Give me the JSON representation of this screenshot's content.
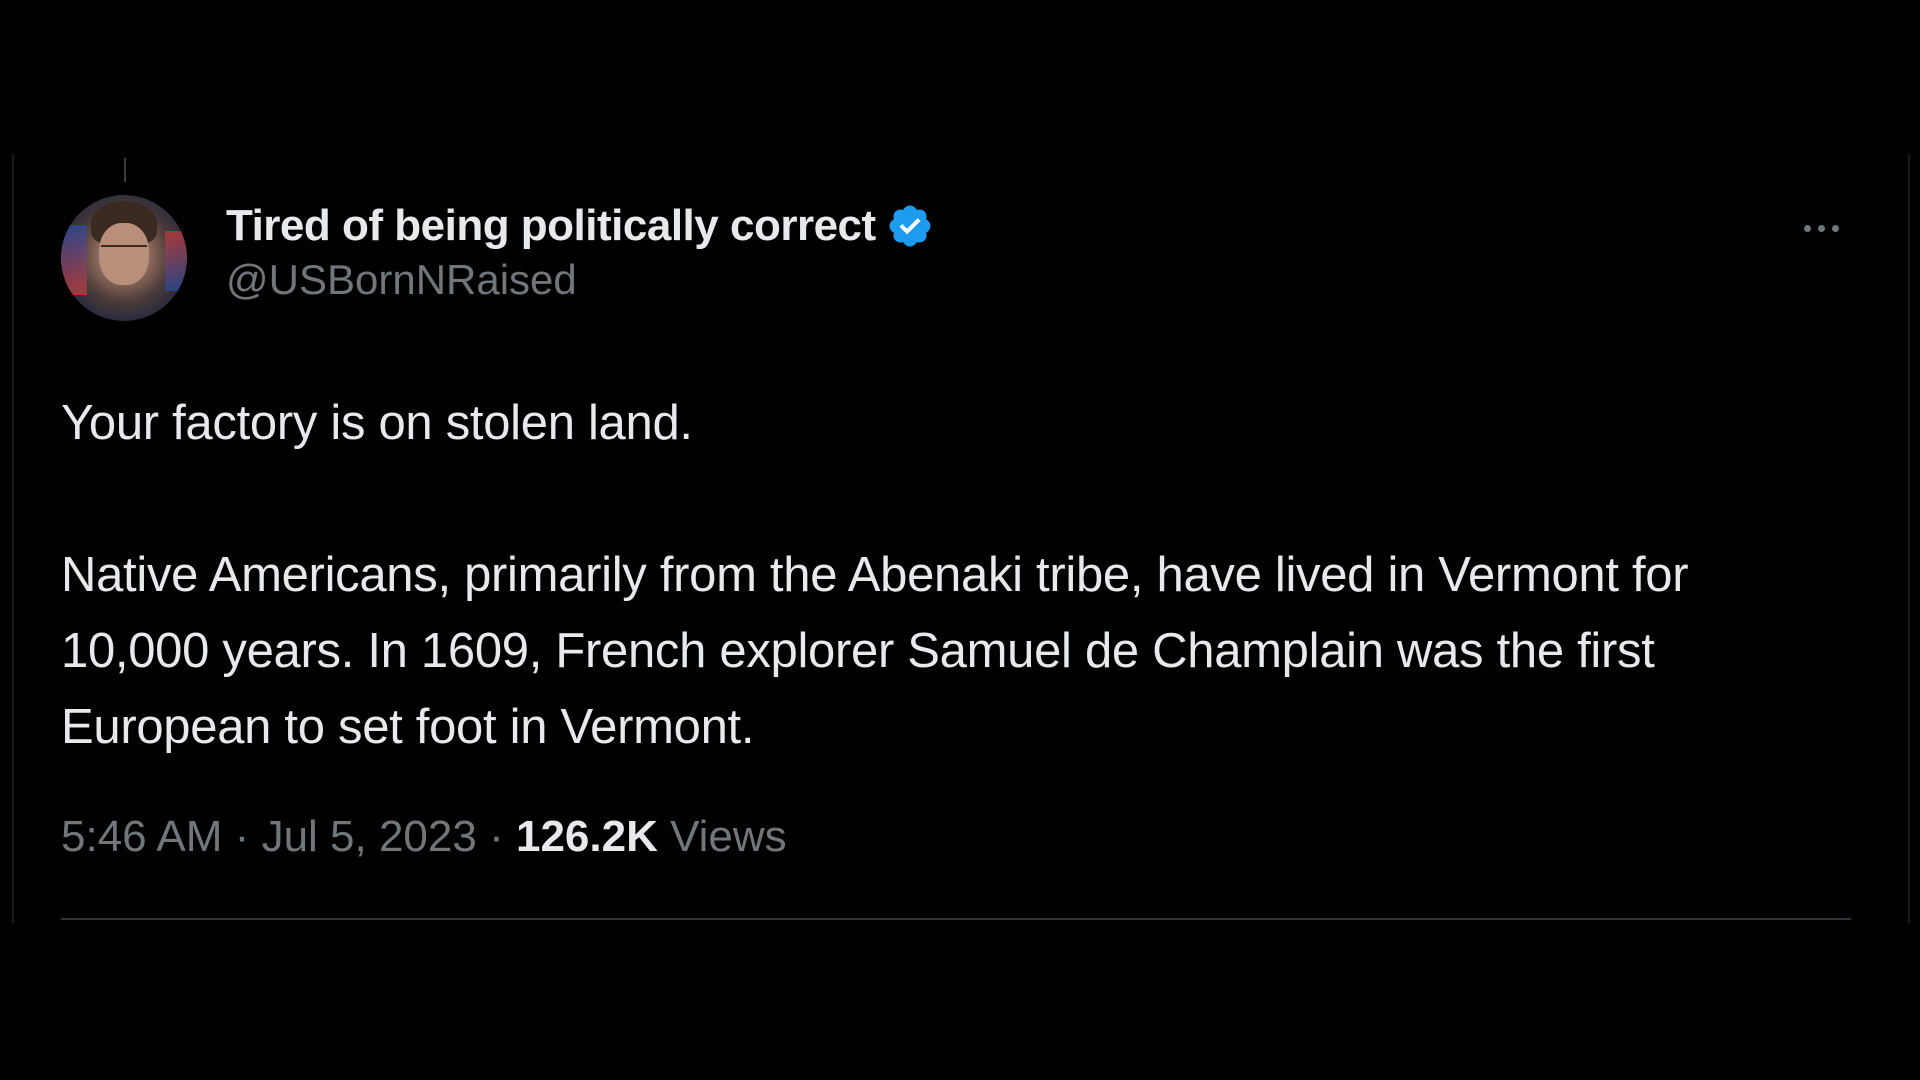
{
  "tweet": {
    "author": {
      "display_name": "Tired of being politically correct",
      "handle": "@USBornNRaised",
      "verified": true
    },
    "body": {
      "line1": "Your factory is on stolen land.",
      "paragraph2": "Native Americans, primarily from the Abenaki tribe, have lived in Vermont for 10,000 years. In 1609, French explorer Samuel de Champlain was the first European to set foot in Vermont."
    },
    "meta": {
      "time": "5:46 AM",
      "separator": "·",
      "date": "Jul 5, 2023",
      "views_count": "126.2K",
      "views_label": "Views"
    }
  },
  "icons": {
    "verified": "verified-badge-icon",
    "more": "more-options-icon"
  },
  "colors": {
    "background": "#000000",
    "text_primary": "#e7e9ea",
    "text_secondary": "#71767b",
    "verified_blue": "#1d9bf0",
    "divider": "#2f3336"
  }
}
